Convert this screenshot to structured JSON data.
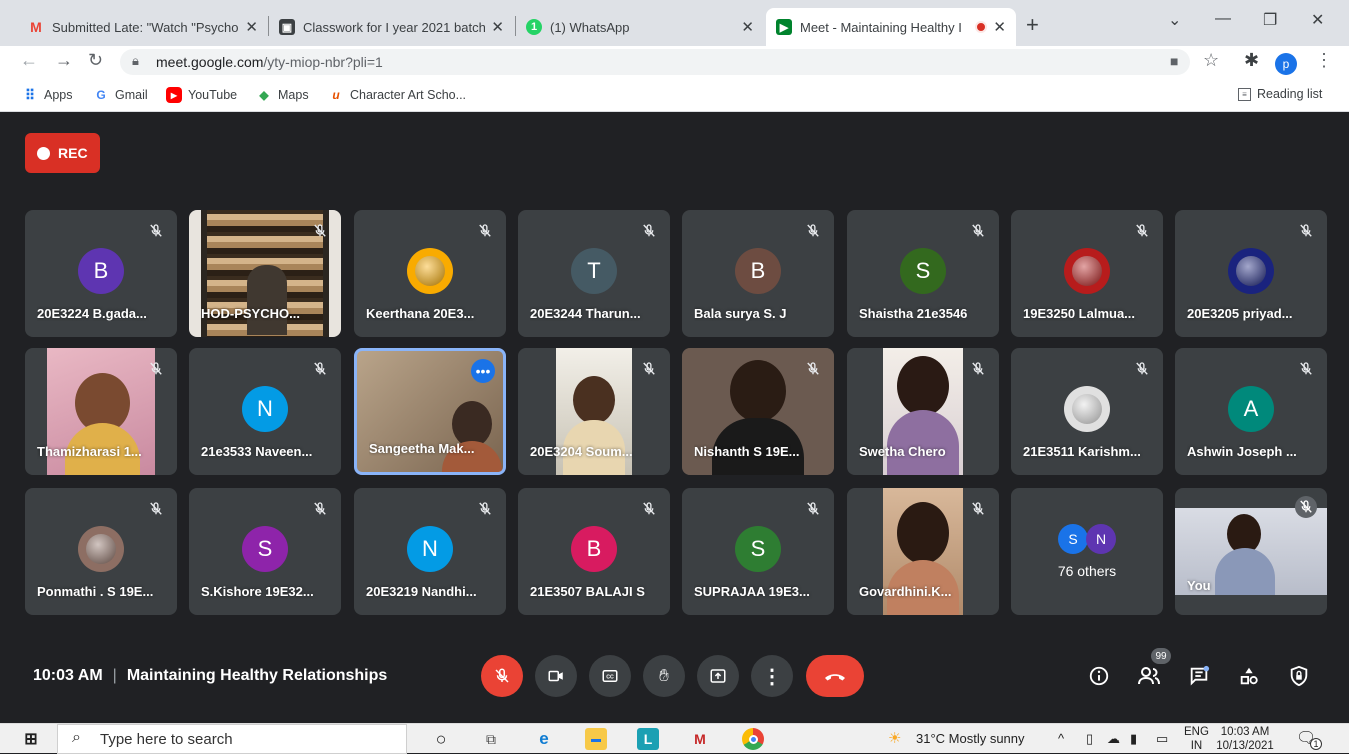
{
  "browser": {
    "tabs": [
      {
        "title": "Submitted Late: \"Watch \"Psycho",
        "icon": "gmail-icon"
      },
      {
        "title": "Classwork for I year 2021 batch",
        "icon": "classroom-icon"
      },
      {
        "title": "(1) WhatsApp",
        "icon": "whatsapp-icon"
      },
      {
        "title": "Meet - Maintaining Healthy I",
        "icon": "meet-icon"
      }
    ],
    "url_host": "meet.google.com",
    "url_path": "/yty-miop-nbr?pli=1",
    "profile_initial": "p",
    "bookmarks": [
      "Apps",
      "Gmail",
      "YouTube",
      "Maps",
      "Character Art Scho..."
    ],
    "reading_list": "Reading list"
  },
  "meet": {
    "rec_label": "REC",
    "participants": [
      {
        "name": "20E3224 B.gada...",
        "initial": "B",
        "color": "#5e35b1"
      },
      {
        "name": "HOD-PSYCHO...",
        "initial": "",
        "color": ""
      },
      {
        "name": "Keerthana 20E3...",
        "initial": "",
        "color": "#f9ab00"
      },
      {
        "name": "20E3244 Tharun...",
        "initial": "T",
        "color": "#455a64"
      },
      {
        "name": "Bala surya S. J",
        "initial": "B",
        "color": "#6d4c41"
      },
      {
        "name": "Shaistha 21e3546",
        "initial": "S",
        "color": "#33691e"
      },
      {
        "name": "19E3250 Lalmua...",
        "initial": "",
        "color": "#b71c1c"
      },
      {
        "name": "20E3205 priyad...",
        "initial": "",
        "color": "#1a237e"
      },
      {
        "name": "Thamizharasi 1...",
        "initial": "",
        "color": ""
      },
      {
        "name": "21e3533 Naveen...",
        "initial": "N",
        "color": "#039be5"
      },
      {
        "name": "Sangeetha Mak...",
        "initial": "",
        "color": ""
      },
      {
        "name": "20E3204 Soum...",
        "initial": "",
        "color": ""
      },
      {
        "name": "Nishanth S 19E...",
        "initial": "",
        "color": ""
      },
      {
        "name": "Swetha Chero",
        "initial": "",
        "color": ""
      },
      {
        "name": "21E3511 Karishm...",
        "initial": "",
        "color": "#e0e0e0"
      },
      {
        "name": "Ashwin Joseph ...",
        "initial": "A",
        "color": "#00897b"
      },
      {
        "name": "Ponmathi . S 19E...",
        "initial": "",
        "color": "#8d6e63"
      },
      {
        "name": "S.Kishore 19E32...",
        "initial": "S",
        "color": "#8e24aa"
      },
      {
        "name": "20E3219 Nandhi...",
        "initial": "N",
        "color": "#039be5"
      },
      {
        "name": "21E3507 BALAJI S",
        "initial": "B",
        "color": "#d81b60"
      },
      {
        "name": "SUPRAJAA 19E3...",
        "initial": "S",
        "color": "#2e7d32"
      },
      {
        "name": "Govardhini.K...",
        "initial": "",
        "color": ""
      }
    ],
    "others": {
      "initials": [
        "S",
        "N"
      ],
      "colors": [
        "#1a73e8",
        "#5e35b1"
      ],
      "label": "76 others"
    },
    "self_label": "You",
    "time": "10:03 AM",
    "meeting_title": "Maintaining Healthy Relationships",
    "people_badge": "99"
  },
  "taskbar": {
    "search_placeholder": "Type here to search",
    "weather": "31°C  Mostly sunny",
    "lang": "ENG",
    "region": "IN",
    "time": "10:03 AM",
    "date": "10/13/2021",
    "notif_count": "1"
  }
}
